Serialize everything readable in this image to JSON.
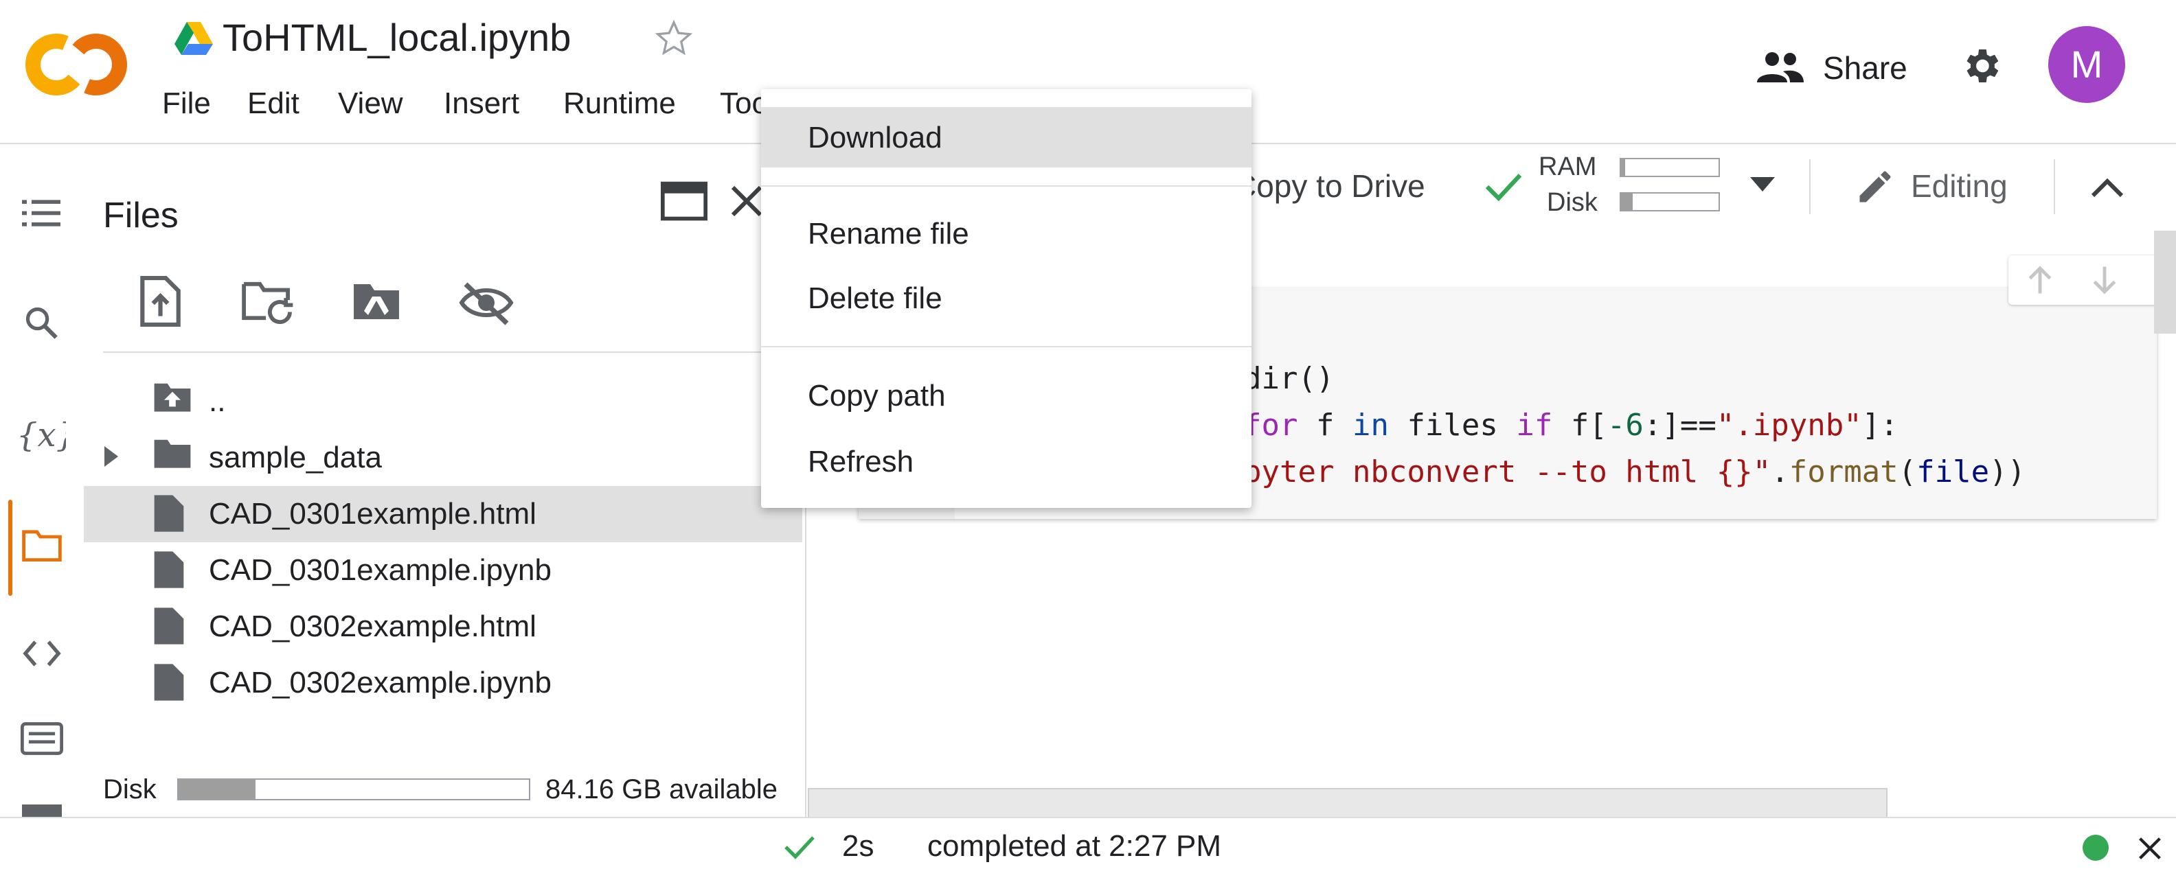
{
  "header": {
    "title": "ToHTML_local.ipynb",
    "menu": [
      "File",
      "Edit",
      "View",
      "Insert",
      "Runtime",
      "Too"
    ],
    "share_label": "Share",
    "avatar_letter": "M"
  },
  "toolbar": {
    "copy_to_drive": "Copy to Drive",
    "ram_label": "RAM",
    "disk_label": "Disk",
    "ram_usage_fraction": 0.04,
    "disk_usage_fraction": 0.12,
    "editing_label": "Editing"
  },
  "files_panel": {
    "title": "Files",
    "items": [
      {
        "name": "..",
        "kind": "parent"
      },
      {
        "name": "sample_data",
        "kind": "folder"
      },
      {
        "name": "CAD_0301example.html",
        "kind": "file",
        "selected": true
      },
      {
        "name": "CAD_0301example.ipynb",
        "kind": "file"
      },
      {
        "name": "CAD_0302example.html",
        "kind": "file"
      },
      {
        "name": "CAD_0302example.ipynb",
        "kind": "file"
      }
    ],
    "disk_label": "Disk",
    "disk_usage_fraction": 0.22,
    "disk_available": "84.16 GB available"
  },
  "context_menu": {
    "items": [
      "Download",
      "Rename file",
      "Delete file",
      "Copy path",
      "Refresh"
    ],
    "highlighted": "Download"
  },
  "code_cell": {
    "line1": "dir()",
    "line2_kw_for": "for",
    "line2_f": " f ",
    "line2_in": "in",
    "line2_files": " files ",
    "line2_if": "if",
    "line2_idx_a": " f[",
    "line2_num": "-6",
    "line2_idx_b": ":]==",
    "line2_str": "\".ipynb\"",
    "line2_end": "]:",
    "line3_str": "pyter nbconvert --to html {}\"",
    "line3_dot": ".",
    "line3_fn": "format",
    "line3_open": "(",
    "line3_var": "file",
    "line3_close": "))"
  },
  "status": {
    "duration": "2s",
    "completed": "completed at 2:27 PM"
  },
  "colors": {
    "accent": "#e8710a",
    "avatar": "#a142c7",
    "ok_green": "#34a853"
  }
}
